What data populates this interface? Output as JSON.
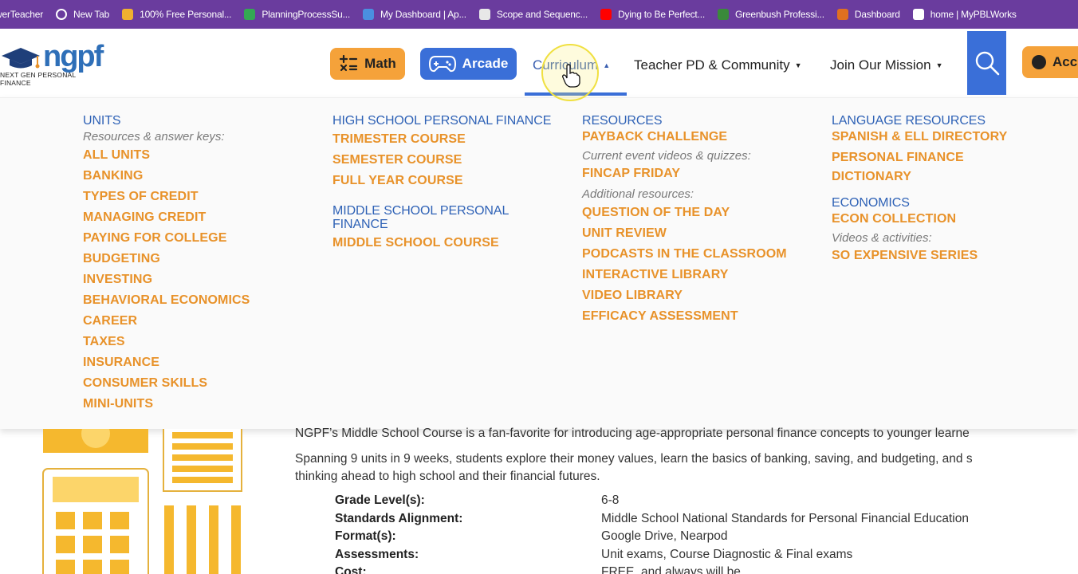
{
  "bookmarks": [
    {
      "label": "werTeacher",
      "color": "#6a3c9e"
    },
    {
      "label": "New Tab",
      "color": "#ffffff"
    },
    {
      "label": "100% Free Personal...",
      "color": "#f0b030"
    },
    {
      "label": "PlanningProcessSu...",
      "color": "#34a853"
    },
    {
      "label": "My Dashboard | Ap...",
      "color": "#4a8fe0"
    },
    {
      "label": "Scope and Sequenc...",
      "color": "#e8e8e8"
    },
    {
      "label": "Dying to Be Perfect...",
      "color": "#ff0000"
    },
    {
      "label": "Greenbush Professi...",
      "color": "#3a8a3a"
    },
    {
      "label": "Dashboard",
      "color": "#e07020"
    },
    {
      "label": "home | MyPBLWorks",
      "color": "#ffffff"
    }
  ],
  "logo": {
    "word": "ngpf",
    "tagline": "NEXT GEN PERSONAL FINANCE"
  },
  "nav": {
    "math": "Math",
    "arcade": "Arcade",
    "curriculum": "Curriculum",
    "teacher_pd": "Teacher PD & Community",
    "join": "Join Our Mission",
    "account": "Acc"
  },
  "menu": {
    "col1": {
      "heading": "UNITS",
      "sub": "Resources & answer keys:",
      "links": [
        "ALL UNITS",
        "BANKING",
        "TYPES OF CREDIT",
        "MANAGING CREDIT",
        "PAYING FOR COLLEGE",
        "BUDGETING",
        "INVESTING",
        "BEHAVIORAL ECONOMICS",
        "CAREER",
        "TAXES",
        "INSURANCE",
        "CONSUMER SKILLS",
        "MINI-UNITS"
      ]
    },
    "col2": {
      "heading1": "HIGH SCHOOL PERSONAL FINANCE",
      "links1": [
        "TRIMESTER COURSE",
        "SEMESTER COURSE",
        "FULL YEAR COURSE"
      ],
      "heading2": "MIDDLE SCHOOL PERSONAL FINANCE",
      "links2": [
        "MIDDLE SCHOOL COURSE"
      ]
    },
    "col3": {
      "heading": "RESOURCES",
      "link_payback": "PAYBACK CHALLENGE",
      "sub_current": "Current event videos & quizzes:",
      "link_fincap": "FINCAP FRIDAY",
      "sub_additional": "Additional resources:",
      "links": [
        "QUESTION OF THE DAY",
        "UNIT REVIEW",
        "PODCASTS IN THE CLASSROOM",
        "INTERACTIVE LIBRARY",
        "VIDEO LIBRARY",
        "EFFICACY ASSESSMENT"
      ]
    },
    "col4": {
      "heading1": "LANGUAGE RESOURCES",
      "link_spanish": "SPANISH & ELL DIRECTORY",
      "link_dictionary": "PERSONAL FINANCE DICTIONARY",
      "heading2": "ECONOMICS",
      "link_econ": "ECON COLLECTION",
      "sub_videos": "Videos & activities:",
      "link_expensive": "SO EXPENSIVE SERIES"
    }
  },
  "content": {
    "p1": "NGPF’s Middle School Course is a fan-favorite for introducing age-appropriate personal finance concepts to younger learne",
    "p2a": "Spanning 9 units in 9 weeks, students explore their money values, learn the basics of banking, saving, and budgeting, and s",
    "p2b": "thinking ahead to high school and their financial futures.",
    "specs": [
      {
        "k": "Grade Level(s):",
        "v": "6-8"
      },
      {
        "k": "Standards Alignment:",
        "v": "Middle School National Standards for Personal Financial Education"
      },
      {
        "k": "Format(s):",
        "v": "Google Drive, Nearpod"
      },
      {
        "k": "Assessments:",
        "v": "Unit exams, Course Diagnostic & Final exams"
      },
      {
        "k": "Cost:",
        "v": "FREE, and always will be"
      }
    ]
  }
}
